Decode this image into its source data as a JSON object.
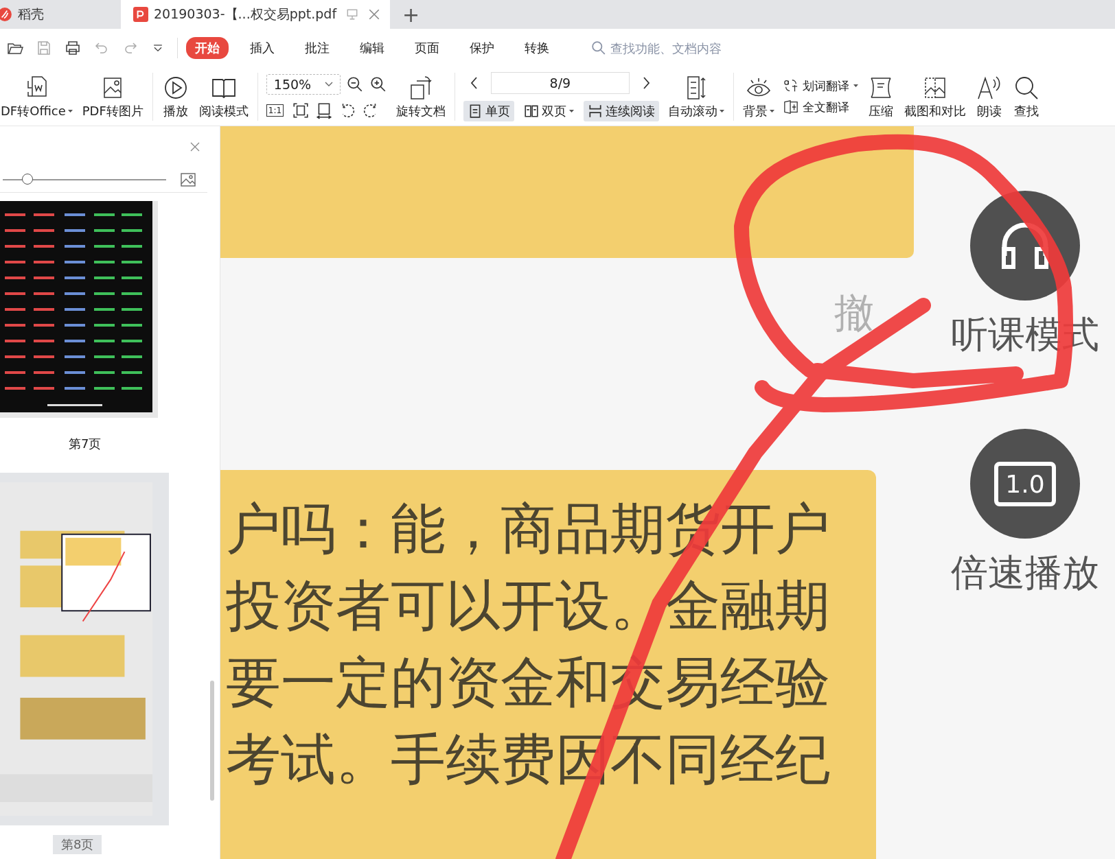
{
  "tabs": [
    {
      "label": "稻壳",
      "selected": false,
      "kind": "home"
    },
    {
      "label": "20190303-【...权交易ppt.pdf",
      "selected": true,
      "kind": "pdf"
    }
  ],
  "new_tab": "+",
  "quick_access": [
    {
      "kind": "open"
    },
    {
      "kind": "save"
    },
    {
      "kind": "print"
    },
    {
      "kind": "undo"
    },
    {
      "kind": "redo"
    },
    {
      "kind": "more"
    }
  ],
  "menu": [
    {
      "label": "开始",
      "selected": true
    },
    {
      "label": "插入",
      "selected": false
    },
    {
      "label": "批注",
      "selected": false
    },
    {
      "label": "编辑",
      "selected": false
    },
    {
      "label": "页面",
      "selected": false
    },
    {
      "label": "保护",
      "selected": false
    },
    {
      "label": "转换",
      "selected": false
    }
  ],
  "search": {
    "placeholder": "查找功能、文档内容"
  },
  "ribbon": {
    "pdf_to_office": {
      "label": "DF转Office",
      "dropdown": true
    },
    "pdf_to_image": {
      "label": "PDF转图片"
    },
    "play": {
      "label": "播放"
    },
    "read_mode": {
      "label": "阅读模式"
    },
    "zoom": {
      "value": "150%"
    },
    "actual_size": "1:1",
    "rotate_doc": {
      "label": "旋转文档"
    },
    "page": {
      "value": "8/9"
    },
    "view_modes": [
      {
        "label": "单页",
        "selected": true,
        "dropdown": false,
        "kind": "single"
      },
      {
        "label": "双页",
        "selected": false,
        "dropdown": true,
        "kind": "double"
      },
      {
        "label": "连续阅读",
        "selected": true,
        "dropdown": false,
        "kind": "continuous"
      }
    ],
    "auto_scroll": {
      "label": "自动滚动",
      "dropdown": true
    },
    "background": {
      "label": "背景",
      "dropdown": true
    },
    "word_translate": {
      "label": "划词翻译",
      "dropdown": true
    },
    "full_translate": {
      "label": "全文翻译"
    },
    "compress": {
      "label": "压缩"
    },
    "screenshot_compare": {
      "label": "截图和对比"
    },
    "read_aloud": {
      "label": "朗读"
    },
    "find": {
      "label": "查找"
    }
  },
  "sidebar": {
    "slider": {
      "level": 0.15
    },
    "thumbnails": [
      {
        "label": "第7页",
        "selected": false,
        "kind": "table"
      },
      {
        "label": "第8页",
        "selected": true,
        "kind": "chat"
      }
    ]
  },
  "page_content": {
    "message_lines": [
      "户吗：能，商品期货开户",
      "投资者可以开设。金融期",
      "要一定的资金和交易经验",
      "考试。手续费因不同经纪"
    ],
    "recall": "撤",
    "side_buttons": [
      {
        "label": "听课模式",
        "kind": "headphones"
      },
      {
        "label": "倍速播放",
        "kind": "speed",
        "icon_text": "1.0"
      }
    ]
  }
}
